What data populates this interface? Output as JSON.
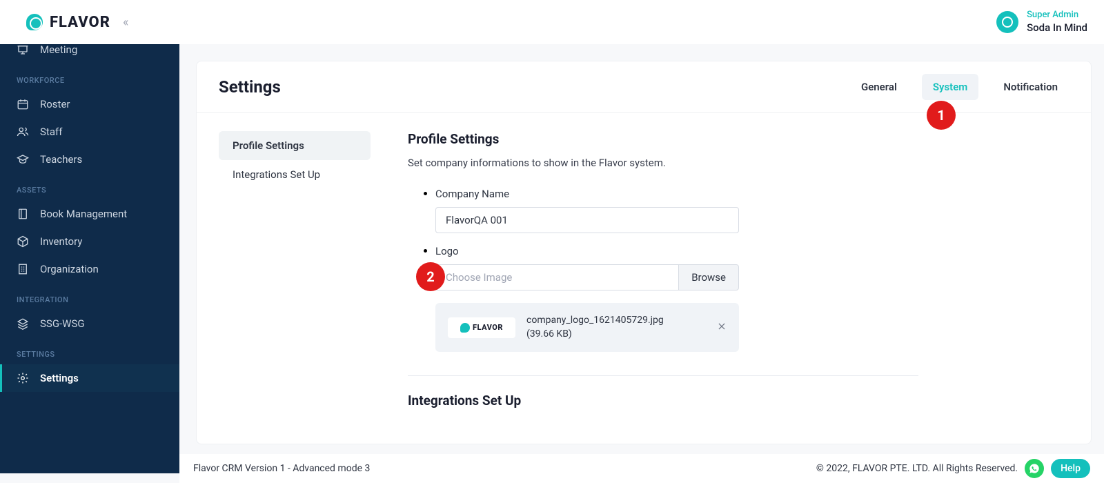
{
  "brand": {
    "name": "FLAVOR"
  },
  "user": {
    "role": "Super Admin",
    "name": "Soda In Mind"
  },
  "sidebar": {
    "top_item": "Meeting",
    "sections": {
      "workforce": {
        "label": "WORKFORCE",
        "items": [
          "Roster",
          "Staff",
          "Teachers"
        ]
      },
      "assets": {
        "label": "ASSETS",
        "items": [
          "Book Management",
          "Inventory",
          "Organization"
        ]
      },
      "integration": {
        "label": "INTEGRATION",
        "items": [
          "SSG-WSG"
        ]
      },
      "settings": {
        "label": "SETTINGS",
        "items": [
          "Settings"
        ]
      }
    }
  },
  "page": {
    "title": "Settings",
    "tabs": {
      "general": "General",
      "system": "System",
      "notification": "Notification"
    }
  },
  "leftnav": {
    "profile": "Profile Settings",
    "integrations": "Integrations Set Up"
  },
  "profile": {
    "heading": "Profile Settings",
    "description": "Set company informations to show in the Flavor system.",
    "fields": {
      "company_name_label": "Company Name",
      "company_name_value": "FlavorQA 001",
      "logo_label": "Logo",
      "choose_placeholder": "Choose Image",
      "browse_label": "Browse",
      "file_name": "company_logo_1621405729.jpg",
      "file_size": "(39.66 KB)"
    }
  },
  "integrations_section": {
    "heading": "Integrations Set Up"
  },
  "footer": {
    "left": "Flavor CRM Version 1 - Advanced mode 3",
    "right": "© 2022, FLAVOR PTE. LTD. All Rights Reserved.",
    "help": "Help"
  },
  "annotations": {
    "a1": "1",
    "a2": "2"
  }
}
